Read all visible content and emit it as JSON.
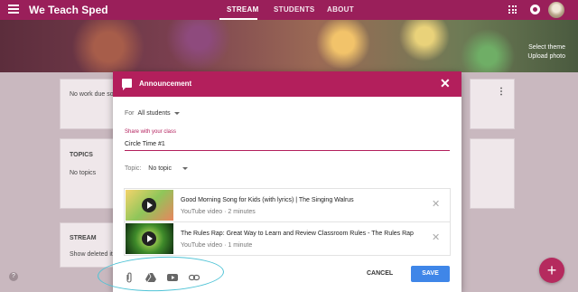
{
  "topbar": {
    "title": "We Teach Sped",
    "tabs": [
      {
        "label": "STREAM",
        "active": true
      },
      {
        "label": "STUDENTS",
        "active": false
      },
      {
        "label": "ABOUT",
        "active": false
      }
    ],
    "color": "#9a1f5a"
  },
  "banner": {
    "select_theme": "Select theme",
    "upload_photo": "Upload photo"
  },
  "background": {
    "upcoming_text": "No work due so",
    "topics_title": "TOPICS",
    "topics_empty": "No topics",
    "stream_title": "STREAM",
    "stream_text": "Show deleted item"
  },
  "dialog": {
    "title": "Announcement",
    "header_color": "#b31f5c",
    "for_label": "For",
    "for_value": "All students",
    "share_label": "Share with your class",
    "share_value": "Circle Time #1",
    "topic_label": "Topic:",
    "topic_value": "No topic",
    "attachments": [
      {
        "name": "Good Morning Song for Kids (with lyrics) | The Singing Walrus",
        "type": "YouTube video",
        "duration": "2 minutes"
      },
      {
        "name": "The Rules Rap: Great Way to Learn and Review Classroom Rules - The Rules Rap",
        "type": "YouTube video",
        "duration": "1 minute"
      }
    ],
    "icons": [
      "paperclip-icon",
      "google-drive-icon",
      "youtube-icon",
      "link-icon"
    ],
    "cancel_label": "CANCEL",
    "save_label": "SAVE",
    "save_color": "#3f86e8"
  },
  "fab_label": "+",
  "help_label": "?"
}
